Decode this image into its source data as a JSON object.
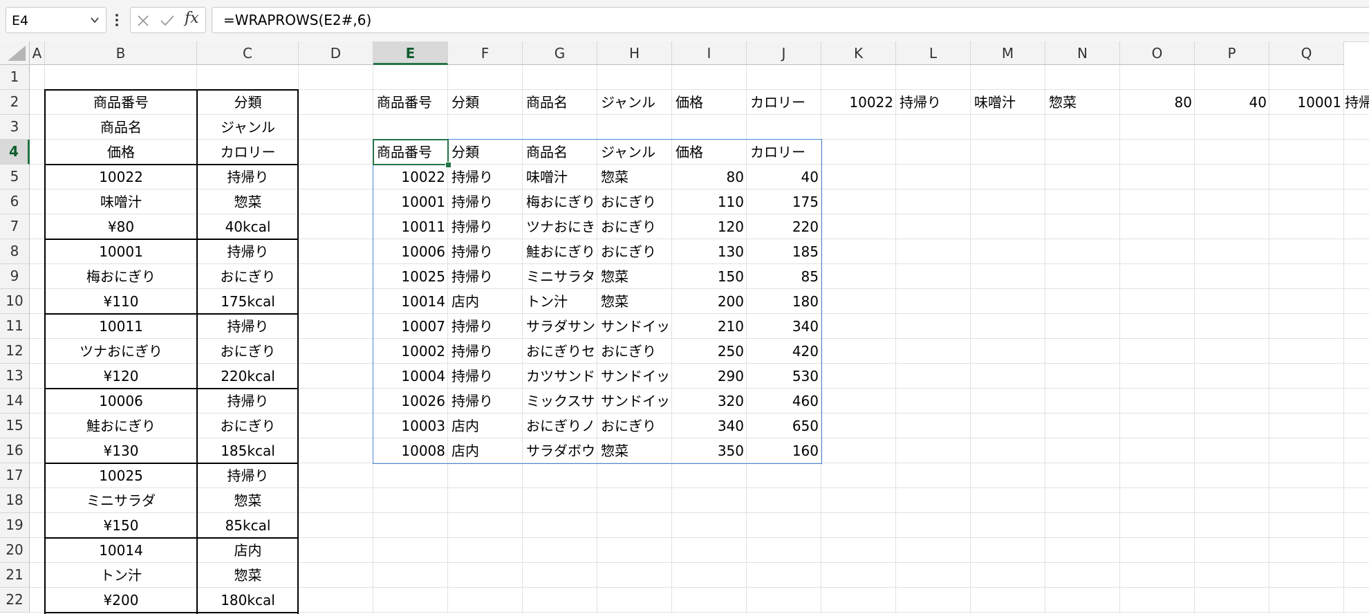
{
  "formula_bar": {
    "name_box": "E4",
    "formula": "=WRAPROWS(E2#,6)",
    "fx_label": "fx"
  },
  "columns": [
    "A",
    "B",
    "C",
    "D",
    "E",
    "F",
    "G",
    "H",
    "I",
    "J",
    "K",
    "L",
    "M",
    "N",
    "O",
    "P",
    "Q"
  ],
  "rows": [
    "1",
    "2",
    "3",
    "4",
    "5",
    "6",
    "7",
    "8",
    "9",
    "10",
    "11",
    "12",
    "13",
    "14",
    "15",
    "16",
    "17",
    "18",
    "19",
    "20",
    "21",
    "22"
  ],
  "active_cell": {
    "column": "E",
    "row": "4"
  },
  "left_table": [
    [
      "商品番号",
      "分類"
    ],
    [
      "商品名",
      "ジャンル"
    ],
    [
      "価格",
      "カロリー"
    ],
    [
      "10022",
      "持帰り"
    ],
    [
      "味噌汁",
      "惣菜"
    ],
    [
      "¥80",
      "40kcal"
    ],
    [
      "10001",
      "持帰り"
    ],
    [
      "梅おにぎり",
      "おにぎり"
    ],
    [
      "¥110",
      "175kcal"
    ],
    [
      "10011",
      "持帰り"
    ],
    [
      "ツナおにぎり",
      "おにぎり"
    ],
    [
      "¥120",
      "220kcal"
    ],
    [
      "10006",
      "持帰り"
    ],
    [
      "鮭おにぎり",
      "おにぎり"
    ],
    [
      "¥130",
      "185kcal"
    ],
    [
      "10025",
      "持帰り"
    ],
    [
      "ミニサラダ",
      "惣菜"
    ],
    [
      "¥150",
      "85kcal"
    ],
    [
      "10014",
      "店内"
    ],
    [
      "トン汁",
      "惣菜"
    ],
    [
      "¥200",
      "180kcal"
    ]
  ],
  "row2_spill": [
    "商品番号",
    "分類",
    "商品名",
    "ジャンル",
    "価格",
    "カロリー",
    "10022",
    "持帰り",
    "味噌汁",
    "惣菜",
    "80",
    "40",
    "10001",
    "持帰"
  ],
  "wrap_table": {
    "header": [
      "商品番号",
      "分類",
      "商品名",
      "ジャンル",
      "価格",
      "カロリー"
    ],
    "rows": [
      [
        "10022",
        "持帰り",
        "味噌汁",
        "惣菜",
        "80",
        "40"
      ],
      [
        "10001",
        "持帰り",
        "梅おにぎり",
        "おにぎり",
        "110",
        "175"
      ],
      [
        "10011",
        "持帰り",
        "ツナおにき",
        "おにぎり",
        "120",
        "220"
      ],
      [
        "10006",
        "持帰り",
        "鮭おにぎり",
        "おにぎり",
        "130",
        "185"
      ],
      [
        "10025",
        "持帰り",
        "ミニサラタ",
        "惣菜",
        "150",
        "85"
      ],
      [
        "10014",
        "店内",
        "トン汁",
        "惣菜",
        "200",
        "180"
      ],
      [
        "10007",
        "持帰り",
        "サラダサン",
        "サンドイッ",
        "210",
        "340"
      ],
      [
        "10002",
        "持帰り",
        "おにぎりセ",
        "おにぎり",
        "250",
        "420"
      ],
      [
        "10004",
        "持帰り",
        "カツサンド",
        "サンドイッ",
        "290",
        "530"
      ],
      [
        "10026",
        "持帰り",
        "ミックスサ",
        "サンドイッ",
        "320",
        "460"
      ],
      [
        "10003",
        "店内",
        "おにぎりノ",
        "おにぎり",
        "340",
        "650"
      ],
      [
        "10008",
        "店内",
        "サラダボウ",
        "惣菜",
        "350",
        "160"
      ]
    ]
  },
  "colors": {
    "accent": "#217346",
    "spill": "#4a86d9",
    "grid": "#e1e1e1",
    "header_bg": "#f3f3f3"
  }
}
